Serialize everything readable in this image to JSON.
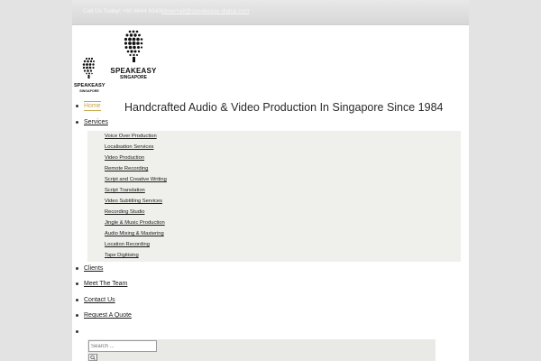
{
  "topbar": {
    "call_prefix": "Call Us Today! +65 6644 6343",
    "email": "biroemail@speakeasy-digital.com"
  },
  "logo": {
    "small_line1": "SPEAKEASY",
    "small_line2": "SINGAPORE",
    "big_line1": "SPEAKEASY",
    "big_line2": "SINGAPORE"
  },
  "header": {
    "tagline": "Handcrafted Audio & Video Production In Singapore Since 1984"
  },
  "nav": {
    "home": "Home",
    "services": "Services",
    "clients": "Clients",
    "team": "Meet The Team",
    "contact": "Contact Us",
    "quote": "Request A Quote"
  },
  "services_menu": [
    "Voice Over Production",
    "Localisation Services",
    "Video Production",
    "Remote Recording",
    "Script and Creative Writing",
    "Script Translation",
    "Video Subtitling Services",
    "Recording Studio",
    "Jingle & Music Production",
    "Audio Mixing & Mastering",
    "Location Recording",
    "Tape Digitising"
  ],
  "search": {
    "placeholder": "Search ..."
  },
  "colors": {
    "accent": "#c9a64a",
    "page_bg": "#e3e3e3",
    "submenu_bg": "#efefec"
  }
}
